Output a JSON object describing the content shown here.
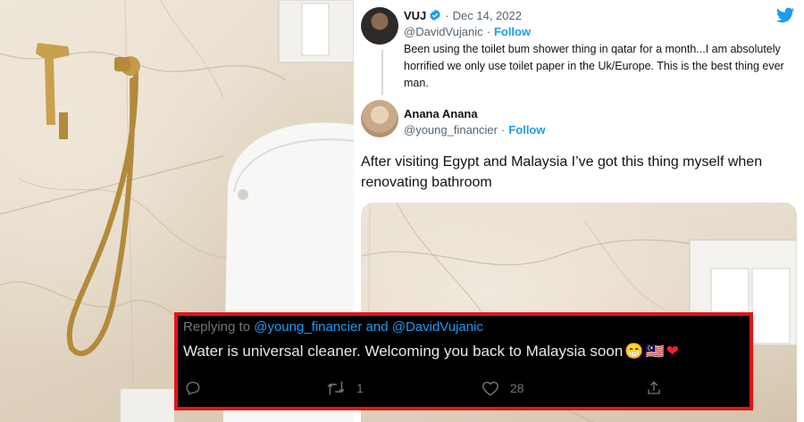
{
  "tweet1": {
    "name": "VUJ",
    "date": "Dec 14, 2022",
    "handle": "@DavidVujanic",
    "separator": "·",
    "follow": "Follow",
    "text": "Been using the toilet bum shower thing in qatar for a month...I am absolutely horrified we only use toilet paper in the Uk/Europe. This is the best thing ever man."
  },
  "tweet2": {
    "name": "Anana Anana",
    "handle": "@young_financier",
    "separator": "·",
    "follow": "Follow",
    "text": "After visiting Egypt and Malaysia I’ve got this thing myself when renovating bathroom"
  },
  "reply": {
    "prefix": "Replying to",
    "handles": "@young_financier and @DavidVujanic",
    "text": "Water is universal cleaner. Welcoming you back to Malaysia soon",
    "emojis": [
      "😁",
      "🇲🇾",
      "❤"
    ],
    "retweets": "1",
    "likes": "28"
  },
  "colors": {
    "accent": "#1d9bf0",
    "reply_border": "#e01616",
    "reply_bg": "#000000",
    "heart": "#f4212e"
  },
  "icons": [
    "verified-icon",
    "twitter-bird-icon",
    "reply-icon",
    "retweet-icon",
    "like-icon",
    "share-icon"
  ]
}
